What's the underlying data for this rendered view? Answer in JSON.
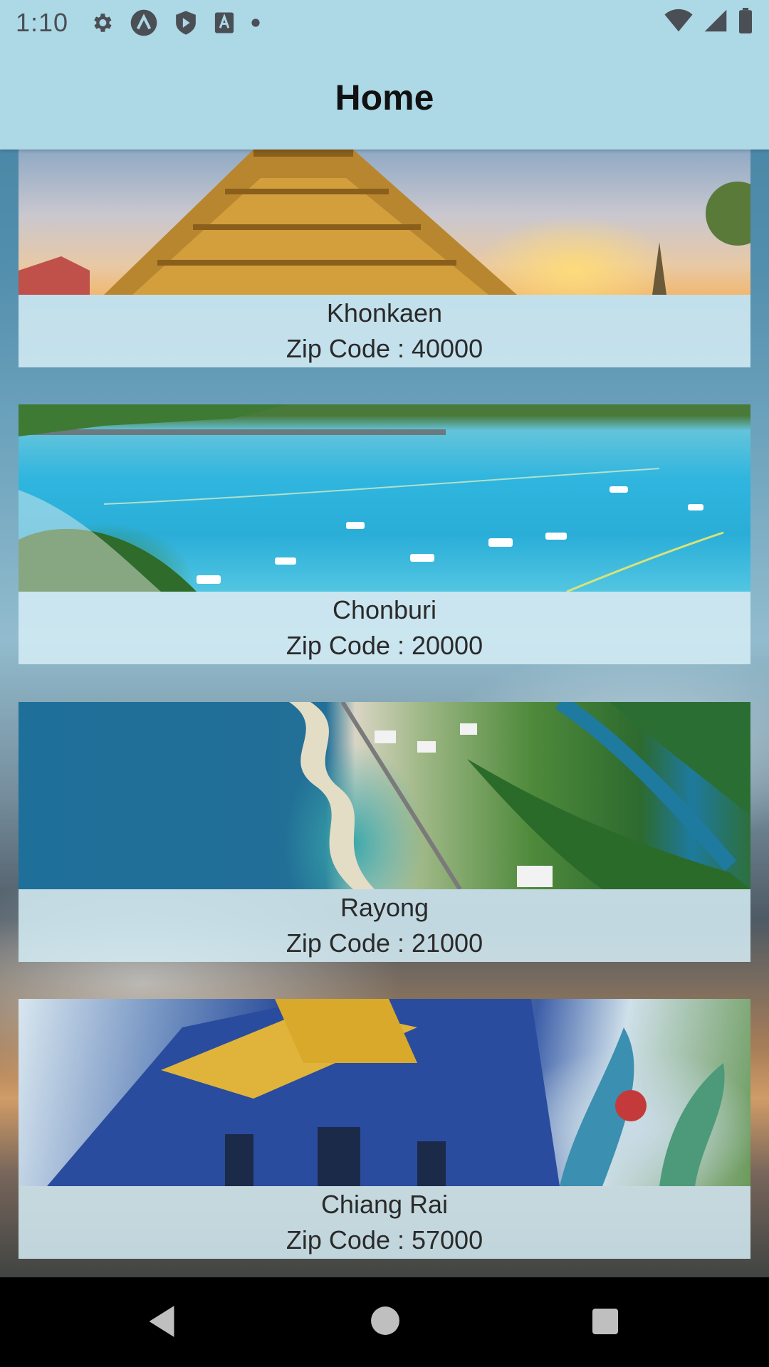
{
  "status_bar": {
    "time": "1:10",
    "icons": [
      "settings-icon",
      "arch-icon",
      "play-shield-icon",
      "font-a-icon",
      "dot-icon"
    ],
    "right_icons": [
      "wifi-icon",
      "signal-icon",
      "battery-icon"
    ]
  },
  "app_bar": {
    "title": "Home"
  },
  "cities": [
    {
      "name": "Khonkaen",
      "zip": "Zip Code : 40000",
      "image": "temple-sunset"
    },
    {
      "name": "Chonburi",
      "zip": "Zip Code : 20000",
      "image": "beach-boats"
    },
    {
      "name": "Rayong",
      "zip": "Zip Code : 21000",
      "image": "aerial-coast"
    },
    {
      "name": "Chiang Rai",
      "zip": "Zip Code : 57000",
      "image": "blue-temple"
    }
  ],
  "nav_bar": {
    "buttons": [
      "back-icon",
      "home-icon",
      "recents-icon"
    ]
  },
  "colors": {
    "app_bar": "#add8e6",
    "caption_bg": "#d4ecf4",
    "nav_bar": "#000000"
  }
}
